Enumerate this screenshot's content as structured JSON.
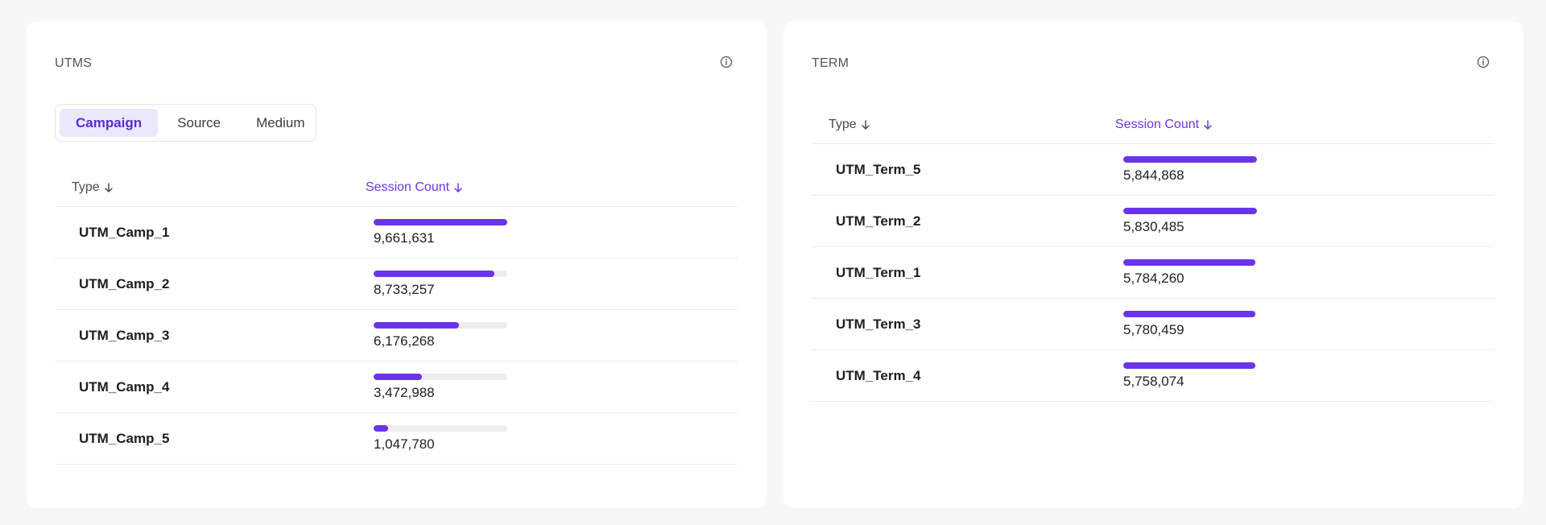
{
  "colors": {
    "accent": "#6a35e8",
    "tab_active_bg": "#ece8fb",
    "bar_track": "#ededed"
  },
  "utms": {
    "title": "UTMS",
    "info_icon": "info-circle-icon",
    "tabs": [
      {
        "label": "Campaign",
        "active": true
      },
      {
        "label": "Source",
        "active": false
      },
      {
        "label": "Medium",
        "active": false
      }
    ],
    "columns": {
      "type": "Type",
      "session_count": "Session Count",
      "sort_icon": "arrow-down-icon"
    },
    "max_value": 9661631,
    "rows": [
      {
        "name": "UTM_Camp_1",
        "value": "9,661,631",
        "count": 9661631
      },
      {
        "name": "UTM_Camp_2",
        "value": "8,733,257",
        "count": 8733257
      },
      {
        "name": "UTM_Camp_3",
        "value": "6,176,268",
        "count": 6176268
      },
      {
        "name": "UTM_Camp_4",
        "value": "3,472,988",
        "count": 3472988
      },
      {
        "name": "UTM_Camp_5",
        "value": "1,047,780",
        "count": 1047780
      }
    ]
  },
  "term": {
    "title": "TERM",
    "info_icon": "info-circle-icon",
    "columns": {
      "type": "Type",
      "session_count": "Session Count",
      "sort_icon": "arrow-down-icon"
    },
    "max_value": 5844868,
    "rows": [
      {
        "name": "UTM_Term_5",
        "value": "5,844,868",
        "count": 5844868
      },
      {
        "name": "UTM_Term_2",
        "value": "5,830,485",
        "count": 5830485
      },
      {
        "name": "UTM_Term_1",
        "value": "5,784,260",
        "count": 5784260
      },
      {
        "name": "UTM_Term_3",
        "value": "5,780,459",
        "count": 5780459
      },
      {
        "name": "UTM_Term_4",
        "value": "5,758,074",
        "count": 5758074
      }
    ]
  }
}
